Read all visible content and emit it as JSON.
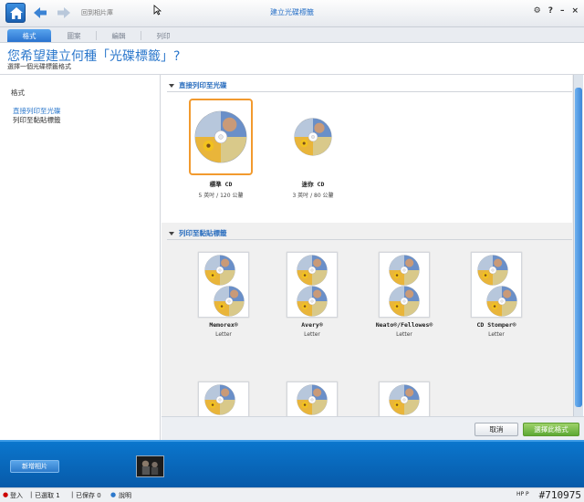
{
  "topbar": {
    "back_link": "回到相片庫",
    "title": "建立光碟標籤",
    "gear": "⚙",
    "help": "?",
    "minimize": "–",
    "close": "×"
  },
  "tabs": [
    {
      "label": "格式",
      "active": true
    },
    {
      "label": "圖案",
      "active": false
    },
    {
      "label": "編輯",
      "active": false
    },
    {
      "label": "列印",
      "active": false
    }
  ],
  "heading": {
    "title": "您希望建立何種「光碟標籤」?",
    "subtitle": "選擇一個光碟標籤格式"
  },
  "sidebar": {
    "title": "格式",
    "links": [
      "直接列印至光碟",
      "列印至黏貼標籤"
    ]
  },
  "direct_print": {
    "heading": "直接列印至光碟",
    "items": [
      {
        "label": "標準 CD",
        "sub": "5 英吋 / 120 公釐",
        "selected": true
      },
      {
        "label": "迷你 CD",
        "sub": "3 英吋 / 80 公釐",
        "selected": false
      }
    ]
  },
  "stickers": {
    "heading": "列印至黏貼標籤",
    "items": [
      {
        "label": "Memorex®",
        "sub": "Letter"
      },
      {
        "label": "Avery®",
        "sub": "Letter"
      },
      {
        "label": "Neato®/Fellowes®",
        "sub": "Letter"
      },
      {
        "label": "CD Stomper®",
        "sub": "Letter"
      }
    ]
  },
  "actions": {
    "cancel": "取消",
    "select": "選擇此格式"
  },
  "tray": {
    "add_photo": "新增相片"
  },
  "status": {
    "login": "登入",
    "selected": "已選取 1",
    "saved": "已保存 0",
    "help": "說明",
    "brand": "HP P",
    "watermark": "#710975"
  },
  "colors": {
    "accent": "#2c78cc",
    "selection": "#f29a2e",
    "primary_button": "#5ea935"
  }
}
